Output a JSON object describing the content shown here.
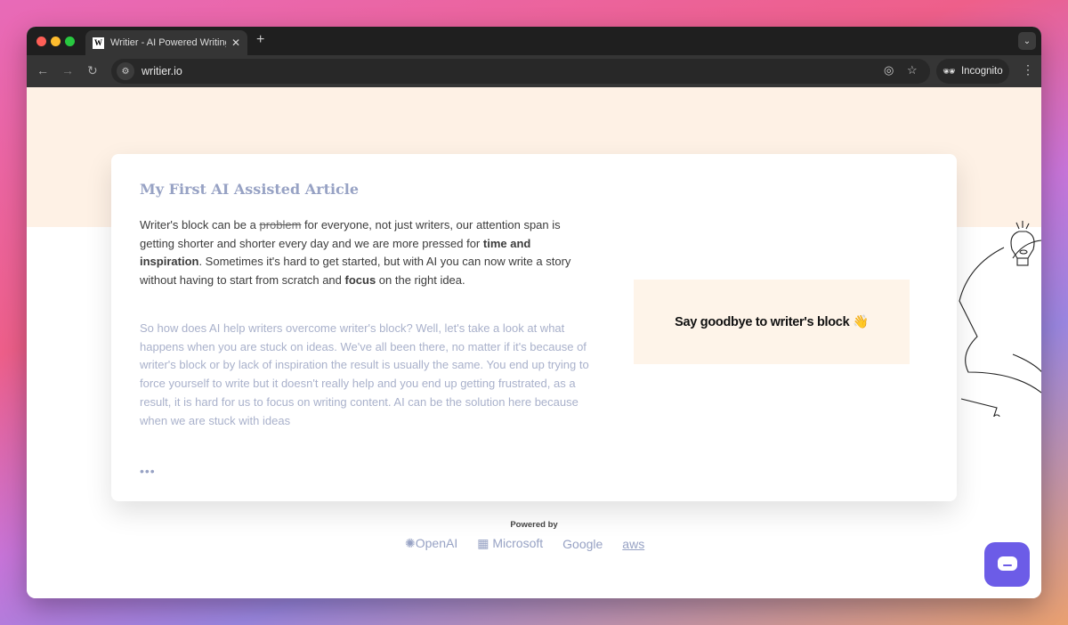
{
  "browser": {
    "tab_title": "Writier - AI Powered Writing Assistant",
    "favicon_letter": "W",
    "url": "writier.io",
    "incognito_label": "Incognito"
  },
  "article": {
    "title": "My First AI Assisted Article",
    "p1": {
      "a": "Writer's block can be a ",
      "strike": "problem",
      "b": " for everyone, not just writers, our attention span is getting shorter and shorter every day and we are more pressed for ",
      "bold1": "time and inspiration",
      "c": ". Sometimes it's hard to get started, but with AI you can now write a story without having to start from scratch and ",
      "bold2": "focus",
      "d": " on the right idea."
    },
    "p2": "So how does AI help writers overcome writer's block? Well, let's take a look at what happens when you are stuck on ideas. We've all been there, no matter if it's because of writer's block or by lack of inspiration the result is usually the same. You end up trying to force yourself to write but it doesn't really help and you end up getting frustrated, as a result, it is hard for us to focus on writing content. AI can be the solution here because when we are stuck with ideas",
    "ellipsis": "•••"
  },
  "promo": "Say goodbye to writer's block 👋",
  "powered_by": {
    "label": "Powered by",
    "logos": [
      "OpenAI",
      "Microsoft",
      "Google",
      "aws"
    ]
  },
  "colors": {
    "accent": "#6c5ce7",
    "title": "#97a2c4",
    "band": "#fef1e5"
  }
}
